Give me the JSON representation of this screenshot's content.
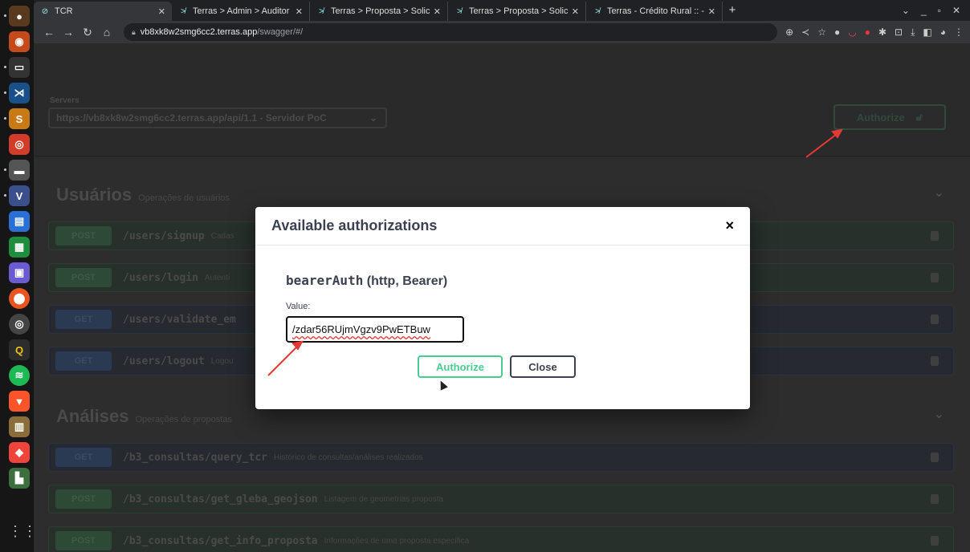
{
  "dock": {
    "icons": [
      "chrome-icon",
      "firefox-icon",
      "terminal-icon",
      "vscode-icon",
      "sublime-icon",
      "postman-icon",
      "files-icon",
      "virtualbox-icon",
      "docs-icon",
      "sheets-icon",
      "screenshot-icon",
      "ubuntu-icon",
      "disks-icon",
      "search-app-icon",
      "spotify-icon",
      "brave-icon",
      "dbeaver-icon",
      "anydesk-icon",
      "monitor-icon"
    ]
  },
  "browser": {
    "tabs": [
      {
        "title": "TCR",
        "active": true
      },
      {
        "title": "Terras > Admin > Auditor",
        "active": false
      },
      {
        "title": "Terras > Proposta > Solici",
        "active": false
      },
      {
        "title": "Terras > Proposta > Solici",
        "active": false
      },
      {
        "title": "Terras - Crédito Rural :: -",
        "active": false
      }
    ],
    "url_host": "vb8xk8w2smg6cc2.terras.app",
    "url_path": "/swagger/#/"
  },
  "servers": {
    "label": "Servers",
    "selected": "https://vb8xk8w2smg6cc2.terras.app/api/1.1 - Servidor PoC"
  },
  "authorize_label": "Authorize",
  "sections": [
    {
      "title": "Usuários",
      "desc": "Operações de usuários"
    },
    {
      "title": "Análises",
      "desc": "Operações de propostas"
    }
  ],
  "operations": [
    {
      "method": "POST",
      "path": "/users/signup",
      "desc": "Cadas"
    },
    {
      "method": "POST",
      "path": "/users/login",
      "desc": "Autenti"
    },
    {
      "method": "GET",
      "path": "/users/validate_em",
      "desc": ""
    },
    {
      "method": "GET",
      "path": "/users/logout",
      "desc": "Logou"
    },
    {
      "method": "GET",
      "path": "/b3_consultas/query_tcr",
      "desc": "Histórico de consultas/análises realizados"
    },
    {
      "method": "POST",
      "path": "/b3_consultas/get_gleba_geojson",
      "desc": "Listagem de geometrias proposta"
    },
    {
      "method": "POST",
      "path": "/b3_consultas/get_info_proposta",
      "desc": "Informações de uma proposta específica"
    }
  ],
  "modal": {
    "title": "Available authorizations",
    "close_glyph": "×",
    "scheme_name": "bearerAuth",
    "scheme_type": "(http, Bearer)",
    "value_label": "Value:",
    "value": "/zdar56RUjmVgzv9PwETBuw",
    "authorize_label": "Authorize",
    "close_label": "Close"
  },
  "colors": {
    "annotation": "#e53935",
    "post": "#49cc90",
    "get": "#61affe"
  }
}
